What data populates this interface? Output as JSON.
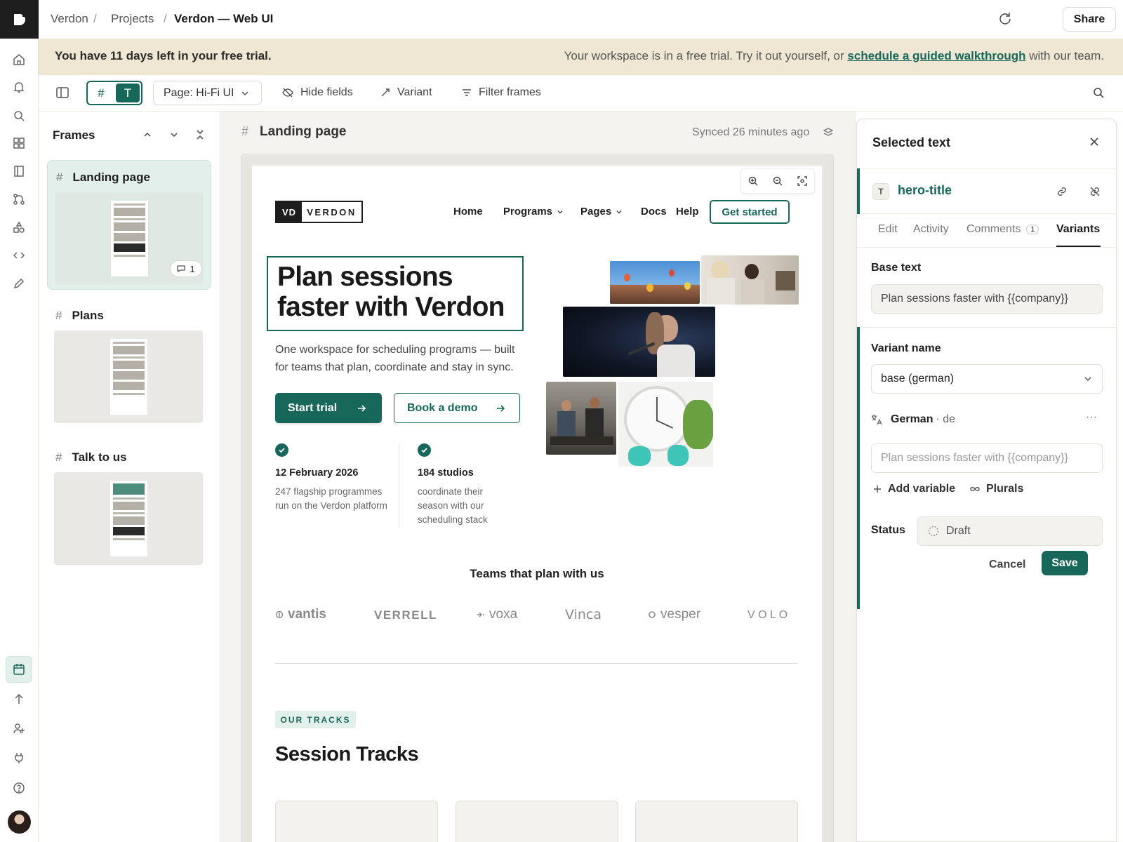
{
  "breadcrumb": {
    "items": [
      "Verdon",
      "Projects"
    ],
    "current": "Verdon — Web UI"
  },
  "topbar": {
    "share_label": "Share",
    "more_label": "···"
  },
  "banner": {
    "left_text": "You have 11 days left in your free trial.",
    "right_prefix": "Your workspace is in a free trial. Try it out yourself, or ",
    "right_link": "schedule a guided walkthrough",
    "right_suffix": " with our team."
  },
  "toolbar": {
    "mode_frames_glyph": "#",
    "mode_text_glyph": "T",
    "page_select_value": "Page: Hi-Fi UI",
    "hide_fields": "Hide fields",
    "variant": "Variant",
    "filter_frames": "Filter frames"
  },
  "frames_panel": {
    "title": "Frames",
    "frames": [
      {
        "name": "Landing page",
        "comment_count": "1"
      },
      {
        "name": "Plans"
      },
      {
        "name": "Talk to us"
      }
    ]
  },
  "canvas": {
    "frame_title": "Landing page",
    "sync_status": "Synced 26 minutes ago",
    "site": {
      "logo_mark": "VD",
      "logo_name": "VERDON",
      "nav": [
        "Home",
        "Programs",
        "Pages",
        "Docs",
        "Help"
      ],
      "nav_cta": "Get started",
      "hero_title": "Plan sessions faster with Verdon",
      "hero_sub": "One workspace for scheduling programs — built for teams that plan, coordinate and stay in sync.",
      "btn_trial": "Start trial",
      "btn_demo": "Book a demo",
      "stats": [
        {
          "title": "12 February 2026",
          "desc": "247 flagship programmes run on the Verdon platform"
        },
        {
          "title": "184 studios",
          "desc": "coordinate their season with our scheduling stack"
        }
      ],
      "teams_heading": "Teams that plan with us",
      "team_logos": [
        "vantis",
        "VERRELL",
        "voxa",
        "Vinca",
        "vesper",
        "V O L O"
      ],
      "tracks_tag": "OUR TRACKS",
      "tracks_title": "Session Tracks"
    }
  },
  "panel": {
    "title": "Selected text",
    "layer_badge": "T",
    "layer_name": "hero-title",
    "tabs": [
      {
        "label": "Edit"
      },
      {
        "label": "Activity"
      },
      {
        "label": "Comments",
        "badge": "1"
      },
      {
        "label": "Variants",
        "active": true
      }
    ],
    "base_text_label": "Base text",
    "base_text_value": "Plan sessions faster with {{company}}",
    "variant_name_label": "Variant name",
    "variant_name_value": "base (german)",
    "language_name": "German",
    "language_code": "· de",
    "german_placeholder": "Plan sessions faster with {{company}}",
    "add_variable": "Add variable",
    "plurals": "Plurals",
    "status_label": "Status",
    "status_value": "Draft",
    "cancel": "Cancel",
    "save": "Save"
  },
  "colors": {
    "accent": "#17685a",
    "banner_bg": "#efe6d3",
    "rail_logo_bg": "#1e1e1e"
  }
}
